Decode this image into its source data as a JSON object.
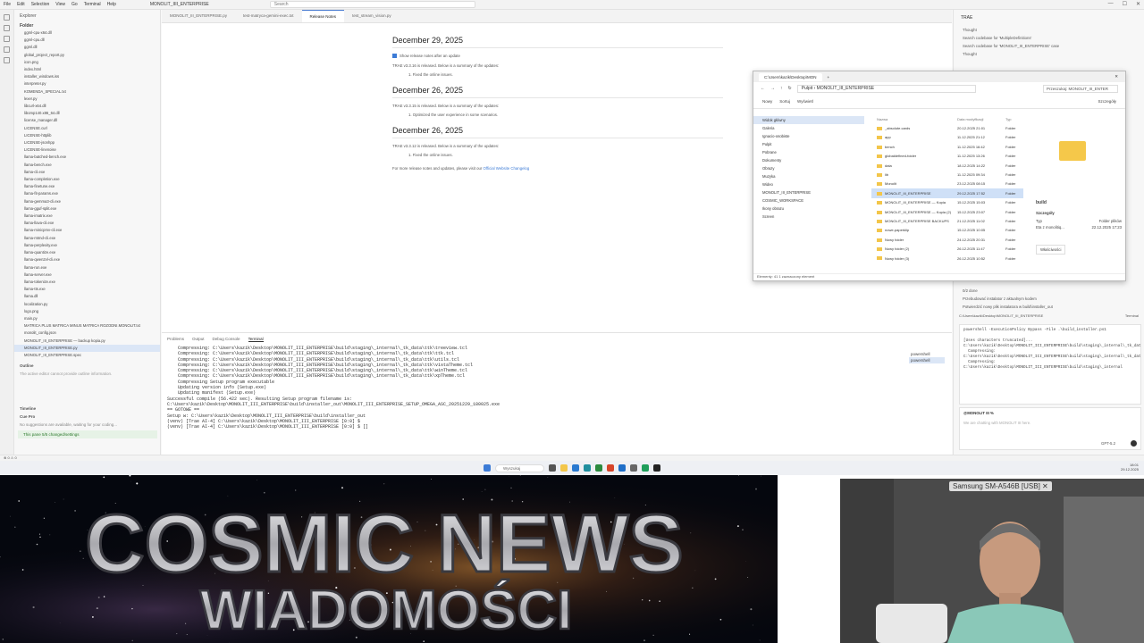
{
  "titlebar": {
    "menus": [
      "File",
      "Edit",
      "Selection",
      "View",
      "Go",
      "Terminal",
      "Help"
    ],
    "window_title": "MONOLIT_IIII_ENTERPRISE",
    "search": "Search"
  },
  "explorer": {
    "header": "Explorer",
    "folder": "Folder",
    "files": [
      "ggml-cpu-x64.dll",
      "ggml-cpu.dll",
      "ggml.dll",
      "global_project_report.py",
      "icon.png",
      "index.html",
      "installer_windows.iss",
      "interpreter.py",
      "KOMENDA_SPECIAL.txt",
      "lexer.py",
      "libcurl-x64.dll",
      "libomp140.x86_64.dll",
      "license_manager.dll",
      "LICENSE.curl",
      "LICENSE-httplib",
      "LICENSE-jsonhpp",
      "LICENSE-linenoise",
      "llama-batched-bench.exe",
      "llama-bench.exe",
      "llama-cli.exe",
      "llama-completion.exe",
      "llama-finetune.exe",
      "llama-fit-params.exe",
      "llama-gemma3-cli.exe",
      "llama-gguf-split.exe",
      "llama-imatrix.exe",
      "llama-llava-cli.exe",
      "llama-minicpmv-cli.exe",
      "llama-mtmd-cli.exe",
      "llama-perplexity.exe",
      "llama-quantize.exe",
      "llama-qwen2vl-cli.exe",
      "llama-run.exe",
      "llama-server.exe",
      "llama-tokenize.exe",
      "llama-tts.exe",
      "llama.dll",
      "localization.py",
      "logo.png",
      "main.py",
      "MATRICA PLUS MATRICA MINUS MATRICA ROZODNI.MONOLIT.txt",
      "monolit_config.json",
      "MONOLIT_III_ENTERPRISE — backup kopia.py",
      "MONOLIT_III_ENTERPRISE.py",
      "MONOLIT_III_ENTERPRISE.spec"
    ],
    "selected_index": 43,
    "outline_header": "Outline",
    "outline_text": "The active editor cannot provide outline information.",
    "timeline": "Timeline",
    "cue_pro": "Cue Pro",
    "cue_msg": "No suggestions are available, waiting for your coding...",
    "cue_btn": "This pane 5/5 changed/settings"
  },
  "tabs": [
    "MONOLIT_III_ENTERPRISE.py",
    "test-matryca-gemini-exec.txt",
    "Release Notes",
    "test_stream_vision.py"
  ],
  "active_tab": 2,
  "release_notes": {
    "h1": "December 29, 2025",
    "show_after_update": "Show release notes after an update",
    "p1": "TRAE v3.3.16 is released. Below is a summary of the updates:",
    "li1": "1. Fixed the online issues.",
    "h2": "December 26, 2025",
    "p2": "TRAE v3.3.15 is released. Below is a summary of the updates:",
    "li2": "1. Optimized the user experience in some scenarios.",
    "h3": "December 26, 2025",
    "p3": "TRAE v3.3.12 is released. Below is a summary of the updates:",
    "li3": "1. Fixed the online issues.",
    "more": "For more release notes and updates, please visit our",
    "link": "Official Website Changelog"
  },
  "panel": {
    "tabs": [
      "Problems",
      "Output",
      "Debug Console",
      "Terminal"
    ],
    "active": 3,
    "terminal_lines": [
      "    Compressing: C:\\Users\\kazik\\Desktop\\MONOLIT_III_ENTERPRISE\\build\\staging\\_internal\\_tk_data\\ttk\\treeview.tcl",
      "    Compressing: C:\\Users\\kazik\\Desktop\\MONOLIT_III_ENTERPRISE\\build\\staging\\_internal\\_tk_data\\ttk\\ttk.tcl",
      "    Compressing: C:\\Users\\kazik\\Desktop\\MONOLIT_III_ENTERPRISE\\build\\staging\\_internal\\_tk_data\\ttk\\utils.tcl",
      "    Compressing: C:\\Users\\kazik\\Desktop\\MONOLIT_III_ENTERPRISE\\build\\staging\\_internal\\_tk_data\\ttk\\vistaTheme.tcl",
      "    Compressing: C:\\Users\\kazik\\Desktop\\MONOLIT_III_ENTERPRISE\\build\\staging\\_internal\\_tk_data\\ttk\\winTheme.tcl",
      "    Compressing: C:\\Users\\kazik\\Desktop\\MONOLIT_III_ENTERPRISE\\build\\staging\\_internal\\_tk_data\\ttk\\xpTheme.tcl",
      "    Compressing Setup program executable",
      "    Updating version info (Setup.exe)",
      "    Updating manifest (Setup.exe)",
      "",
      "",
      "Successful compile (56.422 sec). Resulting Setup program filename is:",
      "C:\\Users\\kazik\\Desktop\\MONOLIT_III_ENTERPRISE\\build\\installer_out\\MONOLIT_III_ENTERPRISE_SETUP_OMEGA_ASC_20251229_180025.exe",
      "== GOTOWE ==",
      "Setup w: C:\\Users\\kazik\\Desktop\\MONOLIT_III_ENTERPRISE\\build\\installer_out",
      "(venv) [Trae AI-4] C:\\Users\\kazik\\Desktop\\MONOLIT_III_ENTERPRISE [0:0] $",
      "(venv) [Trae AI-4] C:\\Users\\kazik\\Desktop\\MONOLIT_III_ENTERPRISE [0:0] $ []"
    ],
    "term_list": [
      "powershell",
      "powershell"
    ]
  },
  "chat": {
    "title": "TRAE",
    "items": [
      "Thought",
      "Search codebase for 'MultipleDefinitions'",
      "Search codebase for 'MONOLIT_III_ENTERPRISE' case",
      "Thought"
    ],
    "mid_items": [
      "0/2 done",
      "Przebudować instalator z aktualnym kodem",
      "Potwierdzić nowy plik instalatora w build\\installer_out"
    ],
    "terminal_title": "C:\\Users\\kazik\\Desktop\\MONOLIT_III_ENTERPRISE",
    "terminal_tag": "Terminal",
    "code": "powershell -ExecutionPolicy Bypass -File .\\build_installer.ps1\n\n[Uses characters truncated]...\nC:\\Users\\kazik\\Desktop\\MONOLIT_III_ENTERPRISE\\build\\staging\\_internal\\_tk_data\\msg\n  Compressing:\nC:\\Users\\kazik\\Desktop\\MONOLIT_III_ENTERPRISE\\build\\staging\\_internal\\_tk_data\\msgcat.msg\n  Compressing:\nC:\\Users\\kazik\\Desktop\\MONOLIT_III_ENTERPRISE\\build\\staging\\_internal",
    "input_label": "@MONOLIT III %",
    "input_placeholder": "We are chatting with MONOLIT III here.",
    "model": "GPT-5.2"
  },
  "file_explorer": {
    "tab": "C:\\Users\\kazik\\Desktop\\MON",
    "path_root": "Pulpit",
    "path": "MONOLIT_III_ENTERPRISE",
    "search": "Przeszukaj: MONOLIT_III_ENTER",
    "toolbar": [
      "Nowy",
      "Sortuj",
      "Wyświetl",
      "Szczegóły"
    ],
    "nav": [
      "Widok główny",
      "Galeria",
      "Ignacio-osobiste",
      "Pulpit",
      "Pobrane",
      "Dokumenty",
      "Obrazy",
      "Muzyka",
      "Wideo",
      "MONOLIT_III_ENTERPRISE",
      "COSMIC_WORKSPACE",
      "Ikony obrazu",
      "Screen"
    ],
    "nav_selected": 0,
    "headers": [
      "Nazwa",
      "Data modyfikacji",
      "Typ"
    ],
    "rows": [
      {
        "name": "_absolute.cards",
        "date": "20.12.2025 21:01",
        "type": "Folder"
      },
      {
        "name": "app",
        "date": "11.12.2025 21:12",
        "type": "Folder"
      },
      {
        "name": "bench",
        "date": "11.12.2025 16:42",
        "type": "Folder"
      },
      {
        "name": "globaldefined-folder",
        "date": "11.12.2025 13:26",
        "type": "Folder"
      },
      {
        "name": "data",
        "date": "18.12.2025 14:22",
        "type": "Folder"
      },
      {
        "name": "lib",
        "date": "11.12.2025 09:34",
        "type": "Folder"
      },
      {
        "name": "Monolit",
        "date": "23.12.2025 08:15",
        "type": "Folder"
      },
      {
        "name": "MONOLIT_III_ENTERPRISE",
        "date": "29.12.2025 17:52",
        "type": "Folder"
      },
      {
        "name": "MONOLIT_III_ENTERPRISE — Kopia",
        "date": "15.12.2025 15:03",
        "type": "Folder"
      },
      {
        "name": "MONOLIT_III_ENTERPRISE — Kopia (2)",
        "date": "15.12.2025 23:07",
        "type": "Folder"
      },
      {
        "name": "MONOLIT_III_ENTERPRISE BACKUPS",
        "date": "21.12.2025 11:02",
        "type": "Folder"
      },
      {
        "name": "nowe-paperklip",
        "date": "15.12.2025 10:05",
        "type": "Folder"
      },
      {
        "name": "Nowy folder",
        "date": "24.12.2025 20:31",
        "type": "Folder"
      },
      {
        "name": "Nowy folder (2)",
        "date": "26.12.2025 11:47",
        "type": "Folder"
      },
      {
        "name": "Nowy folder (3)",
        "date": "26.12.2025 10:52",
        "type": "Folder"
      }
    ],
    "selected_row": 7,
    "preview_name": "build",
    "preview_props": "Szczegóły",
    "preview_type_label": "Typ",
    "preview_type": "Folder plików",
    "preview_path": "Eta z monolitiq...",
    "preview_date": "22.12.2025 17:23",
    "share": "Właściwości",
    "status": "Elementy: 41   1 zaznaczony element"
  },
  "taskbar": {
    "search": "Wyszukaj",
    "time": "18:01",
    "date": "29.12.2025"
  },
  "statusbar": "⊗ 0 ⚠ 0",
  "banner": {
    "line1": "COSMIC NEWS",
    "line2": "WIADOMOŚCI"
  },
  "webcam": {
    "label": "Samsung SM-A546B [USB]"
  },
  "colors": {
    "accent": "#3c7bd6",
    "banner_text": "#c8c8cc",
    "banner_bg": "#05070e"
  }
}
